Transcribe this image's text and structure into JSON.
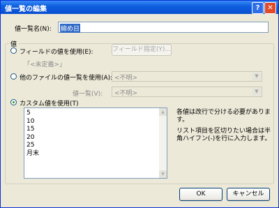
{
  "window": {
    "title": "値一覧の編集"
  },
  "titlebar": {
    "help_label": "?",
    "close_label": "✕"
  },
  "name": {
    "label": "値一覧名(N):",
    "value": "締め日"
  },
  "values_group": {
    "title": "値"
  },
  "field_option": {
    "label": "フィールドの値を使用(E):",
    "sublabel": "「<未定義>」",
    "button_label": "フィールド指定(Y)..."
  },
  "file_option": {
    "label": "他のファイルの値一覧を使用(A):",
    "dropdown_value": "<不明>"
  },
  "list_selector": {
    "label": "値一覧(V):",
    "dropdown_value": "<不明>"
  },
  "custom_option": {
    "label": "カスタム値を使用(T)",
    "values": [
      "5",
      "10",
      "15",
      "20",
      "25",
      "月末"
    ]
  },
  "notes": {
    "line1": "各値は改行で分ける必要があります。",
    "line2": "リスト項目を区切りたい場合は半角ハイフン(-)を行に入力します。"
  },
  "footer": {
    "ok_label": "OK",
    "cancel_label": "キャンセル"
  }
}
